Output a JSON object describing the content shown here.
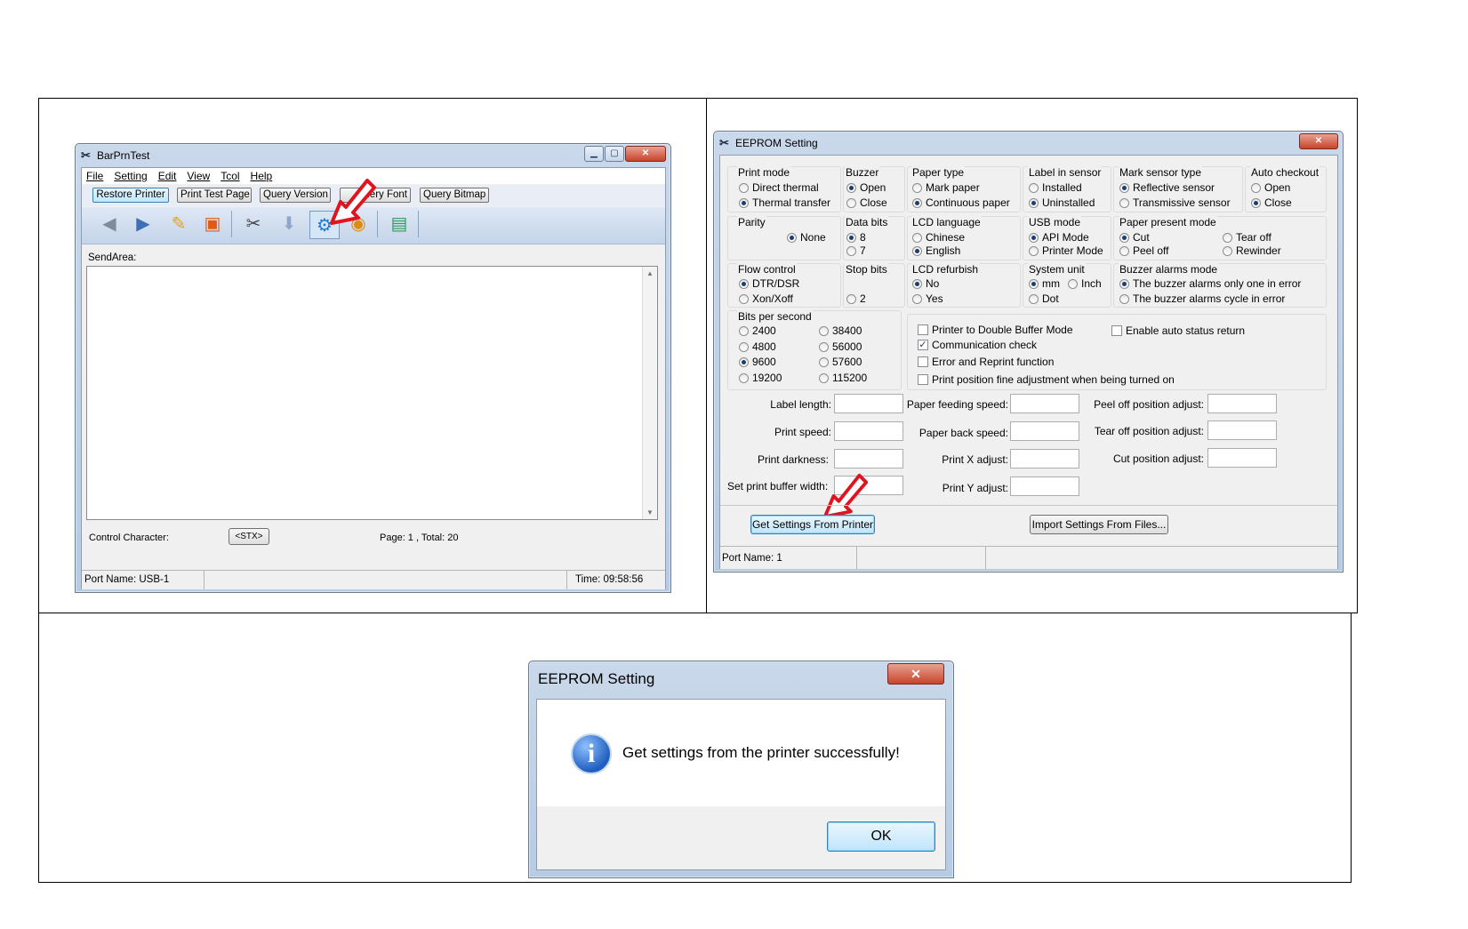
{
  "left_window": {
    "title": "BarPrnTest",
    "menu": [
      "File",
      "Setting",
      "Edit",
      "View",
      "Tcol",
      "Help"
    ],
    "quick_buttons": [
      "Restore Printer",
      "Print Test Page",
      "Query Version",
      "Query Font",
      "Query Bitmap"
    ],
    "send_area_label": "SendArea:",
    "control_character_label": "Control Character:",
    "stx_button": "<STX>",
    "page_info": "Page: 1 , Total: 20",
    "port_name": "Port Name: USB-1",
    "time": "Time: 09:58:56"
  },
  "eeprom_window": {
    "title": "EEPROM Setting",
    "print_mode": {
      "label": "Print mode",
      "options": [
        "Direct thermal",
        "Thermal transfer"
      ],
      "selected": "Thermal transfer"
    },
    "buzzer": {
      "label": "Buzzer",
      "options": [
        "Open",
        "Close"
      ],
      "selected": "Open"
    },
    "paper_type": {
      "label": "Paper type",
      "options": [
        "Mark paper",
        "Continuous paper"
      ],
      "selected": "Continuous paper"
    },
    "label_in_sensor": {
      "label": "Label in sensor",
      "options": [
        "Installed",
        "Uninstalled"
      ],
      "selected": "Uninstalled"
    },
    "mark_sensor_type": {
      "label": "Mark sensor type",
      "options": [
        "Reflective sensor",
        "Transmissive sensor"
      ],
      "selected": "Reflective sensor"
    },
    "auto_checkout": {
      "label": "Auto checkout",
      "options": [
        "Open",
        "Close"
      ],
      "selected": "Close"
    },
    "parity": {
      "label": "Parity",
      "options": [
        "None"
      ],
      "selected": "None"
    },
    "data_bits": {
      "label": "Data bits",
      "options": [
        "8",
        "7"
      ],
      "selected": "8"
    },
    "lcd_language": {
      "label": "LCD language",
      "options": [
        "Chinese",
        "English"
      ],
      "selected": "English"
    },
    "usb_mode": {
      "label": "USB mode",
      "options": [
        "API Mode",
        "Printer Mode"
      ],
      "selected": "API Mode"
    },
    "paper_present_mode": {
      "label": "Paper present mode",
      "options": [
        "Cut",
        "Tear off",
        "Peel off",
        "Rewinder"
      ],
      "selected": "Cut"
    },
    "flow_control": {
      "label": "Flow control",
      "options": [
        "DTR/DSR",
        "Xon/Xoff"
      ],
      "selected": "DTR/DSR"
    },
    "stop_bits": {
      "label": "Stop bits",
      "options": [
        "2"
      ],
      "selected": ""
    },
    "lcd_refurbish": {
      "label": "LCD refurbish",
      "options": [
        "No",
        "Yes"
      ],
      "selected": "No"
    },
    "system_unit": {
      "label": "System unit",
      "options": [
        "mm",
        "Inch",
        "Dot"
      ],
      "selected": "mm"
    },
    "buzzer_alarms_mode": {
      "label": "Buzzer alarms mode",
      "options": [
        "The buzzer alarms only one in error",
        "The buzzer alarms cycle in error"
      ],
      "selected": "The buzzer alarms only one in error"
    },
    "bits_per_second": {
      "label": "Bits per second",
      "options": [
        "2400",
        "38400",
        "4800",
        "56000",
        "9600",
        "57600",
        "19200",
        "115200"
      ],
      "selected": "9600"
    },
    "checkboxes": [
      {
        "label": "Printer to Double Buffer Mode",
        "checked": false
      },
      {
        "label": "Enable auto status return",
        "checked": false
      },
      {
        "label": "Communication check",
        "checked": true
      },
      {
        "label": "Error and Reprint function",
        "checked": false
      },
      {
        "label": "Print position fine adjustment when being turned on",
        "checked": false
      }
    ],
    "fields": {
      "label_length": "Label length:",
      "print_speed": "Print speed:",
      "print_darkness": "Print darkness:",
      "set_print_buffer_width": "Set print buffer width:",
      "paper_feeding_speed": "Paper feeding speed:",
      "paper_back_speed": "Paper back speed:",
      "print_x_adjust": "Print X adjust:",
      "print_y_adjust": "Print Y adjust:",
      "peel_off_position_adjust": "Peel off position adjust:",
      "tear_off_position_adjust": "Tear off position adjust:",
      "cut_position_adjust": "Cut position adjust:"
    },
    "get_settings_button": "Get Settings From Printer",
    "import_settings_button": "Import Settings From Files...",
    "port_name": "Port Name: 1"
  },
  "message_dialog": {
    "title": "EEPROM Setting",
    "message": "Get settings from the printer successfully!",
    "ok_button": "OK"
  },
  "colors": {
    "accent_arrow": "#e0141e",
    "info_icon": "#1f5fbf",
    "close_button": "#c7442b"
  }
}
